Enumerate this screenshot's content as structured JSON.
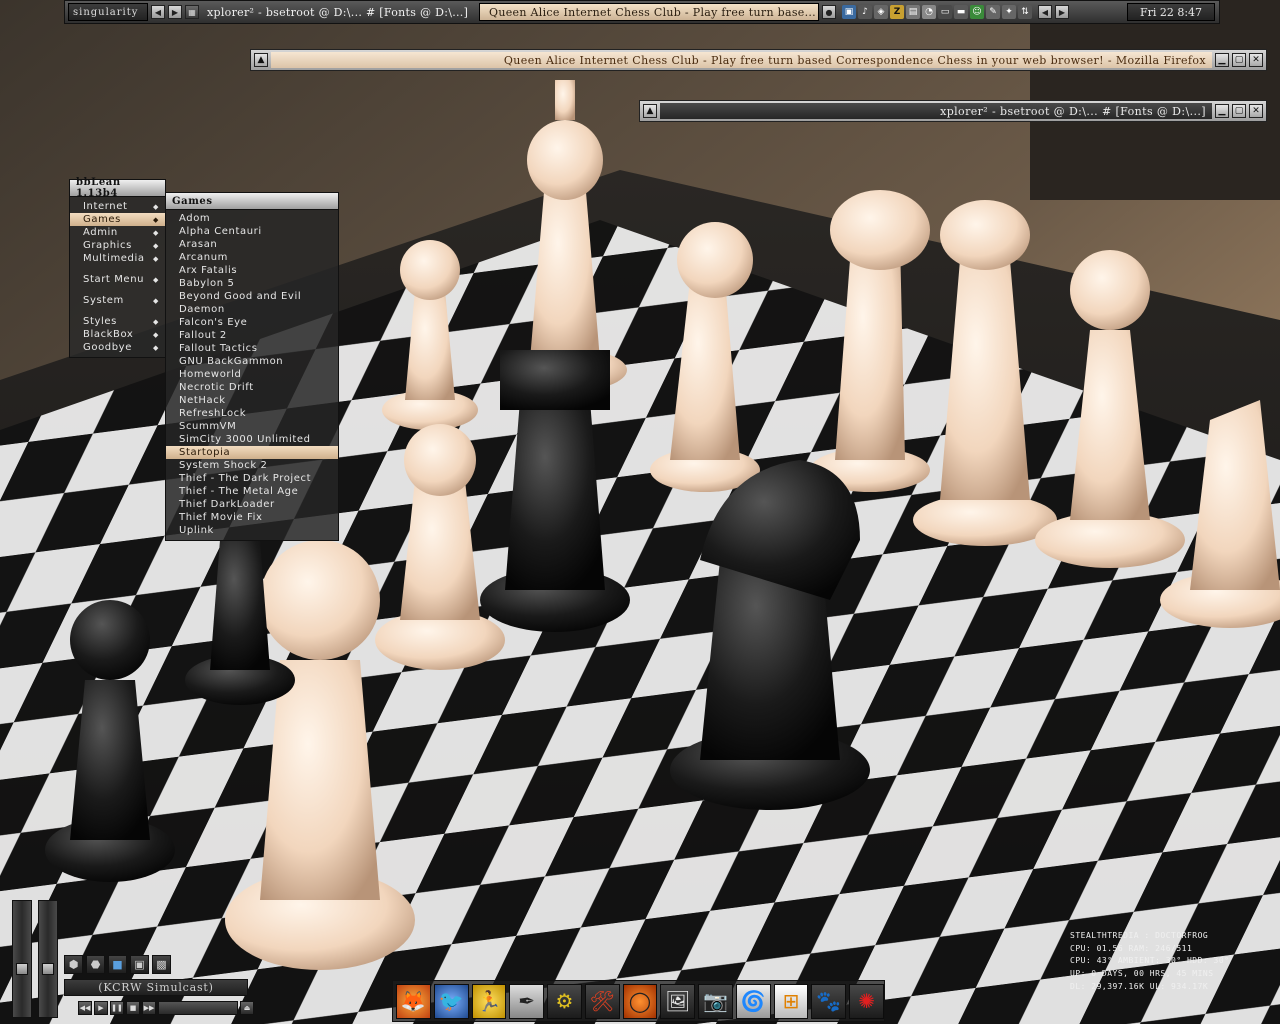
{
  "topbar": {
    "workspace": "singularity",
    "tasks": [
      {
        "label": "xplorer² - bsetroot @ D:\\... # [Fonts @ D:\\...]",
        "active": false
      },
      {
        "label": "Queen Alice Internet Chess Club - Play free turn base...",
        "active": true
      }
    ],
    "clock": "Fri 22 8:47"
  },
  "windows": {
    "firefox": {
      "title": "Queen Alice Internet Chess Club - Play free turn based Correspondence Chess in your web browser! - Mozilla Firefox"
    },
    "xplorer": {
      "title": "xplorer² - bsetroot @ D:\\... # [Fonts @ D:\\...]"
    }
  },
  "root_menu": {
    "title": "bbLean 1.13b4",
    "items": [
      {
        "label": "Internet"
      },
      {
        "label": "Games",
        "active": true
      },
      {
        "label": "Admin"
      },
      {
        "label": "Graphics"
      },
      {
        "label": "Multimedia"
      },
      {
        "label": "Start Menu"
      },
      {
        "label": "System"
      },
      {
        "label": "Styles"
      },
      {
        "label": "BlackBox"
      },
      {
        "label": "Goodbye"
      }
    ]
  },
  "games_menu": {
    "title": "Games",
    "items": [
      {
        "label": "Adom"
      },
      {
        "label": "Alpha Centauri"
      },
      {
        "label": "Arasan"
      },
      {
        "label": "Arcanum"
      },
      {
        "label": "Arx Fatalis"
      },
      {
        "label": "Babylon 5"
      },
      {
        "label": "Beyond Good and Evil"
      },
      {
        "label": "Daemon"
      },
      {
        "label": "Falcon's Eye"
      },
      {
        "label": "Fallout 2"
      },
      {
        "label": "Fallout Tactics"
      },
      {
        "label": "GNU BackGammon"
      },
      {
        "label": "Homeworld"
      },
      {
        "label": "Necrotic Drift"
      },
      {
        "label": "NetHack"
      },
      {
        "label": "RefreshLock"
      },
      {
        "label": "ScummVM"
      },
      {
        "label": "SimCity 3000 Unlimited"
      },
      {
        "label": "Startopia",
        "active": true
      },
      {
        "label": "System Shock 2"
      },
      {
        "label": "Thief - The Dark Project"
      },
      {
        "label": "Thief - The Metal Age"
      },
      {
        "label": "Thief DarkLoader"
      },
      {
        "label": "Thief Movie Fix"
      },
      {
        "label": "Uplink"
      }
    ]
  },
  "media": {
    "station": "(KCRW Simulcast)"
  },
  "dock": [
    {
      "icon": "firefox-icon",
      "glyph": "🦊"
    },
    {
      "icon": "thunderbird-icon",
      "glyph": "🐦"
    },
    {
      "icon": "aim-icon",
      "glyph": "🏃"
    },
    {
      "icon": "editor-icon",
      "glyph": "✒"
    },
    {
      "icon": "utility-icon",
      "glyph": "⚙"
    },
    {
      "icon": "tool-icon",
      "glyph": "🛠"
    },
    {
      "icon": "ring-icon",
      "glyph": "◯"
    },
    {
      "icon": "images-icon",
      "glyph": "🖼"
    },
    {
      "icon": "camera-icon",
      "glyph": "📷"
    },
    {
      "icon": "picasa-icon",
      "glyph": "🌀"
    },
    {
      "icon": "windows-icon",
      "glyph": "⊞"
    },
    {
      "icon": "gimp-icon",
      "glyph": "🐾"
    },
    {
      "icon": "splat-icon",
      "glyph": "✺"
    }
  ],
  "sysmon": {
    "lines": [
      "STEALTHTREDIA : DOCTORFROG",
      "CPU: 01.56   RAM: 246/511",
      "CPU: 43°  AMBIENT: 30°  HDD: 30°",
      "UP: 0 DAYS, 00 HRS, 45 MINS",
      "DL: 29,397.16K  UL: 934.17K"
    ]
  }
}
